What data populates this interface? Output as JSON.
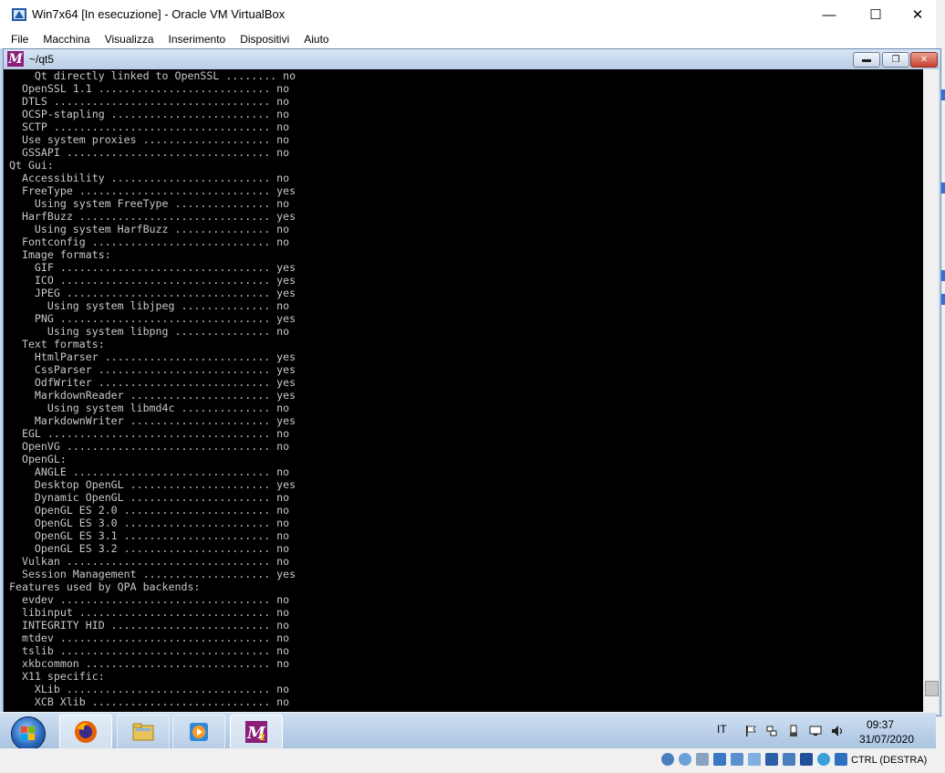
{
  "host_window": {
    "title": "Win7x64 [In esecuzione] - Oracle VM VirtualBox",
    "controls": {
      "minimize": "—",
      "maximize": "☐",
      "close": "✕"
    }
  },
  "menu": {
    "items": [
      "File",
      "Macchina",
      "Visualizza",
      "Inserimento",
      "Dispositivi",
      "Aiuto"
    ]
  },
  "terminal": {
    "title": "~/qt5",
    "icon_letter": "M",
    "lines": [
      "    Qt directly linked to OpenSSL ........ no",
      "  OpenSSL 1.1 ........................... no",
      "  DTLS .................................. no",
      "  OCSP-stapling ......................... no",
      "  SCTP .................................. no",
      "  Use system proxies .................... no",
      "  GSSAPI ................................ no",
      "Qt Gui:",
      "  Accessibility ......................... no",
      "  FreeType .............................. yes",
      "    Using system FreeType ............... no",
      "  HarfBuzz .............................. yes",
      "    Using system HarfBuzz ............... no",
      "  Fontconfig ............................ no",
      "  Image formats:",
      "    GIF ................................. yes",
      "    ICO ................................. yes",
      "    JPEG ................................ yes",
      "      Using system libjpeg .............. no",
      "    PNG ................................. yes",
      "      Using system libpng ............... no",
      "  Text formats:",
      "    HtmlParser .......................... yes",
      "    CssParser ........................... yes",
      "    OdfWriter ........................... yes",
      "    MarkdownReader ...................... yes",
      "      Using system libmd4c .............. no",
      "    MarkdownWriter ...................... yes",
      "  EGL ................................... no",
      "  OpenVG ................................ no",
      "  OpenGL:",
      "    ANGLE ............................... no",
      "    Desktop OpenGL ...................... yes",
      "    Dynamic OpenGL ...................... no",
      "    OpenGL ES 2.0 ....................... no",
      "    OpenGL ES 3.0 ....................... no",
      "    OpenGL ES 3.1 ....................... no",
      "    OpenGL ES 3.2 ....................... no",
      "  Vulkan ................................ no",
      "  Session Management .................... yes",
      "Features used by QPA backends:",
      "  evdev ................................. no",
      "  libinput .............................. no",
      "  INTEGRITY HID ......................... no",
      "  mtdev ................................. no",
      "  tslib ................................. no",
      "  xkbcommon ............................. no",
      "  X11 specific:",
      "    XLib ................................ no",
      "    XCB Xlib ............................ no"
    ]
  },
  "taskbar": {
    "language": "IT",
    "clock_time": "09:37",
    "clock_date": "31/07/2020",
    "apps": [
      "firefox-icon",
      "file-explorer-icon",
      "media-player-icon",
      "msys-icon"
    ]
  },
  "status_bar": {
    "host_key": "CTRL (DESTRA)"
  },
  "colors": {
    "terminal_bg": "#000000",
    "terminal_fg": "#c8c8c8",
    "taskbar": "#a9c3e0"
  }
}
